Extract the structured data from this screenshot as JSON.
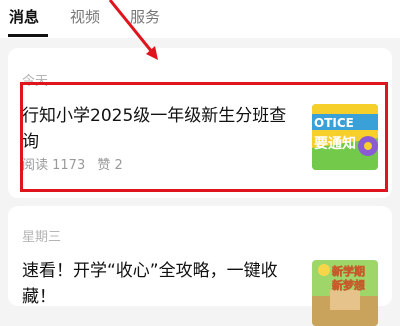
{
  "tabs": [
    {
      "label": "消息"
    },
    {
      "label": "视频"
    },
    {
      "label": "服务"
    }
  ],
  "articles": [
    {
      "date": "今天",
      "title": "行知小学2025级一年级新生分班查询",
      "reads": "阅读 1173",
      "likes": "赞 2",
      "thumb_text_top": "OTICE",
      "thumb_text_bottom": "要通知"
    },
    {
      "date": "星期三",
      "title": "速看！开学“收心”全攻略，一键收藏！",
      "thumb_text_top": "新学期",
      "thumb_text_bottom": "新梦想"
    }
  ],
  "colors": {
    "highlight": "#e0141c",
    "notice_yellow": "#f6cf2a",
    "notice_green": "#73c94a"
  },
  "icons": {
    "annotation": "arrow-annotation"
  }
}
